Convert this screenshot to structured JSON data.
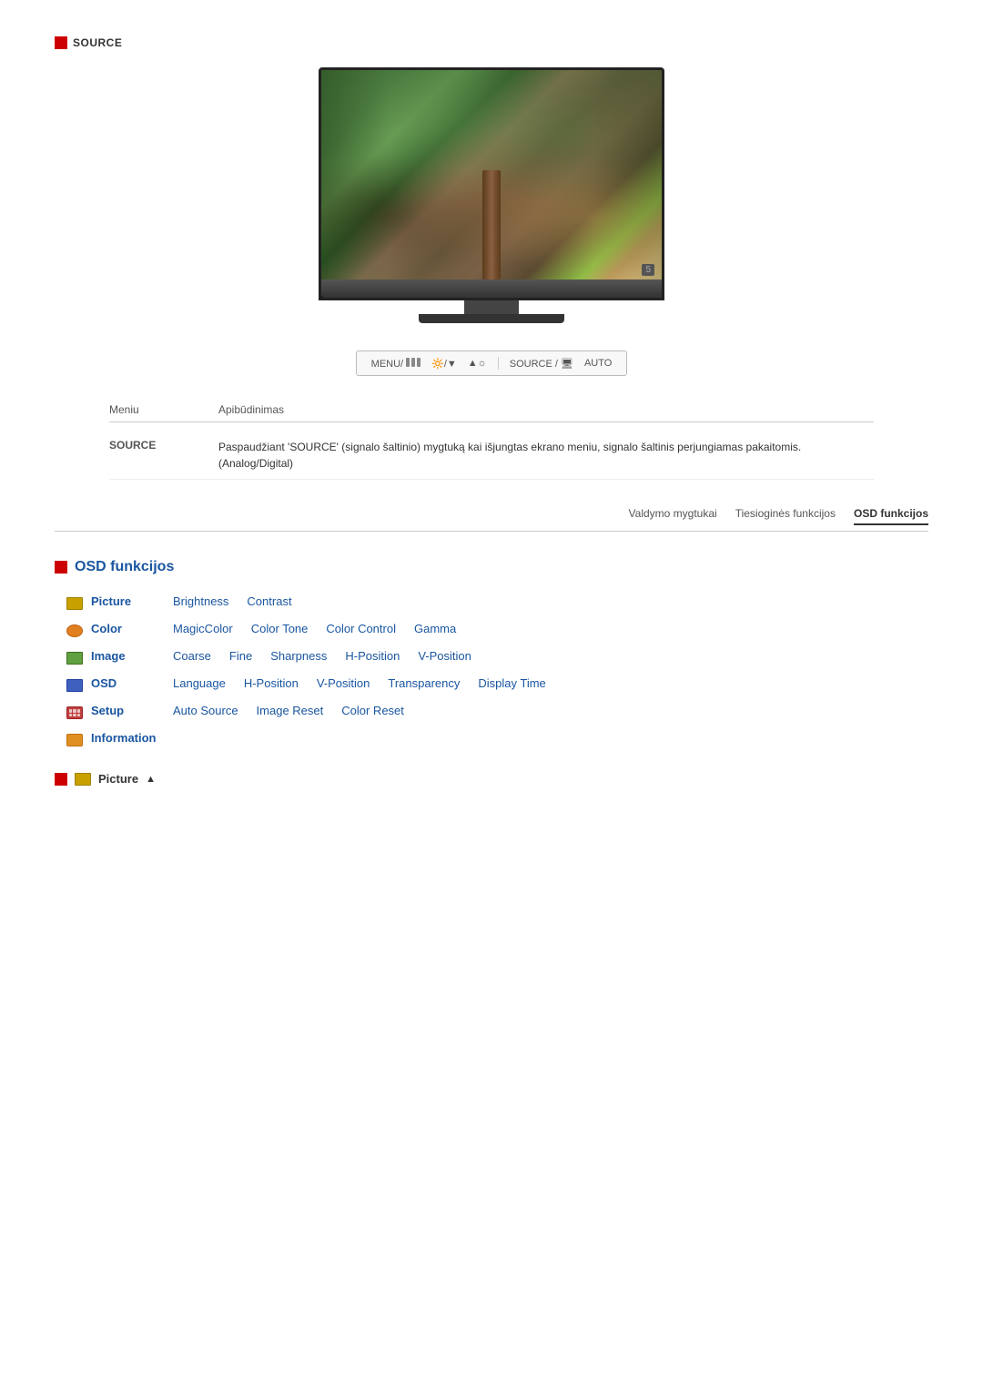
{
  "source_header": {
    "icon_label": "■",
    "label": "SOURCE"
  },
  "monitor": {
    "number": "5"
  },
  "button_bar": {
    "menu_label": "MENU/",
    "brightness_label": "▲/☼",
    "arrow_label": "▲",
    "source_label": "SOURCE /",
    "auto_label": "AUTO"
  },
  "table": {
    "col_menu": "Meniu",
    "col_desc": "Apibūdinimas",
    "rows": [
      {
        "menu": "SOURCE",
        "desc": "Paspaudžiant 'SOURCE' (signalo šaltinio) mygtuką kai išjungtas ekrano meniu, signalo šaltinis perjungiamas pakaitomis. (Analog/Digital)"
      }
    ]
  },
  "nav_tabs": [
    {
      "label": "Valdymo mygtukai",
      "active": false
    },
    {
      "label": "Tiesioginės funkcijos",
      "active": false
    },
    {
      "label": "OSD funkcijos",
      "active": true
    }
  ],
  "osd_section": {
    "title": "OSD funkcijos",
    "menu_rows": [
      {
        "icon_type": "picture",
        "main_label": "Picture",
        "sub_items": [
          "Brightness",
          "Contrast"
        ]
      },
      {
        "icon_type": "color",
        "main_label": "Color",
        "sub_items": [
          "MagicColor",
          "Color Tone",
          "Color Control",
          "Gamma"
        ]
      },
      {
        "icon_type": "image",
        "main_label": "Image",
        "sub_items": [
          "Coarse",
          "Fine",
          "Sharpness",
          "H-Position",
          "V-Position"
        ]
      },
      {
        "icon_type": "osd",
        "main_label": "OSD",
        "sub_items": [
          "Language",
          "H-Position",
          "V-Position",
          "Transparency",
          "Display Time"
        ]
      },
      {
        "icon_type": "setup",
        "main_label": "Setup",
        "sub_items": [
          "Auto Source",
          "Image Reset",
          "Color Reset"
        ]
      },
      {
        "icon_type": "info",
        "main_label": "Information",
        "sub_items": []
      }
    ]
  },
  "footer": {
    "label": "Picture",
    "arrow": "▲"
  }
}
